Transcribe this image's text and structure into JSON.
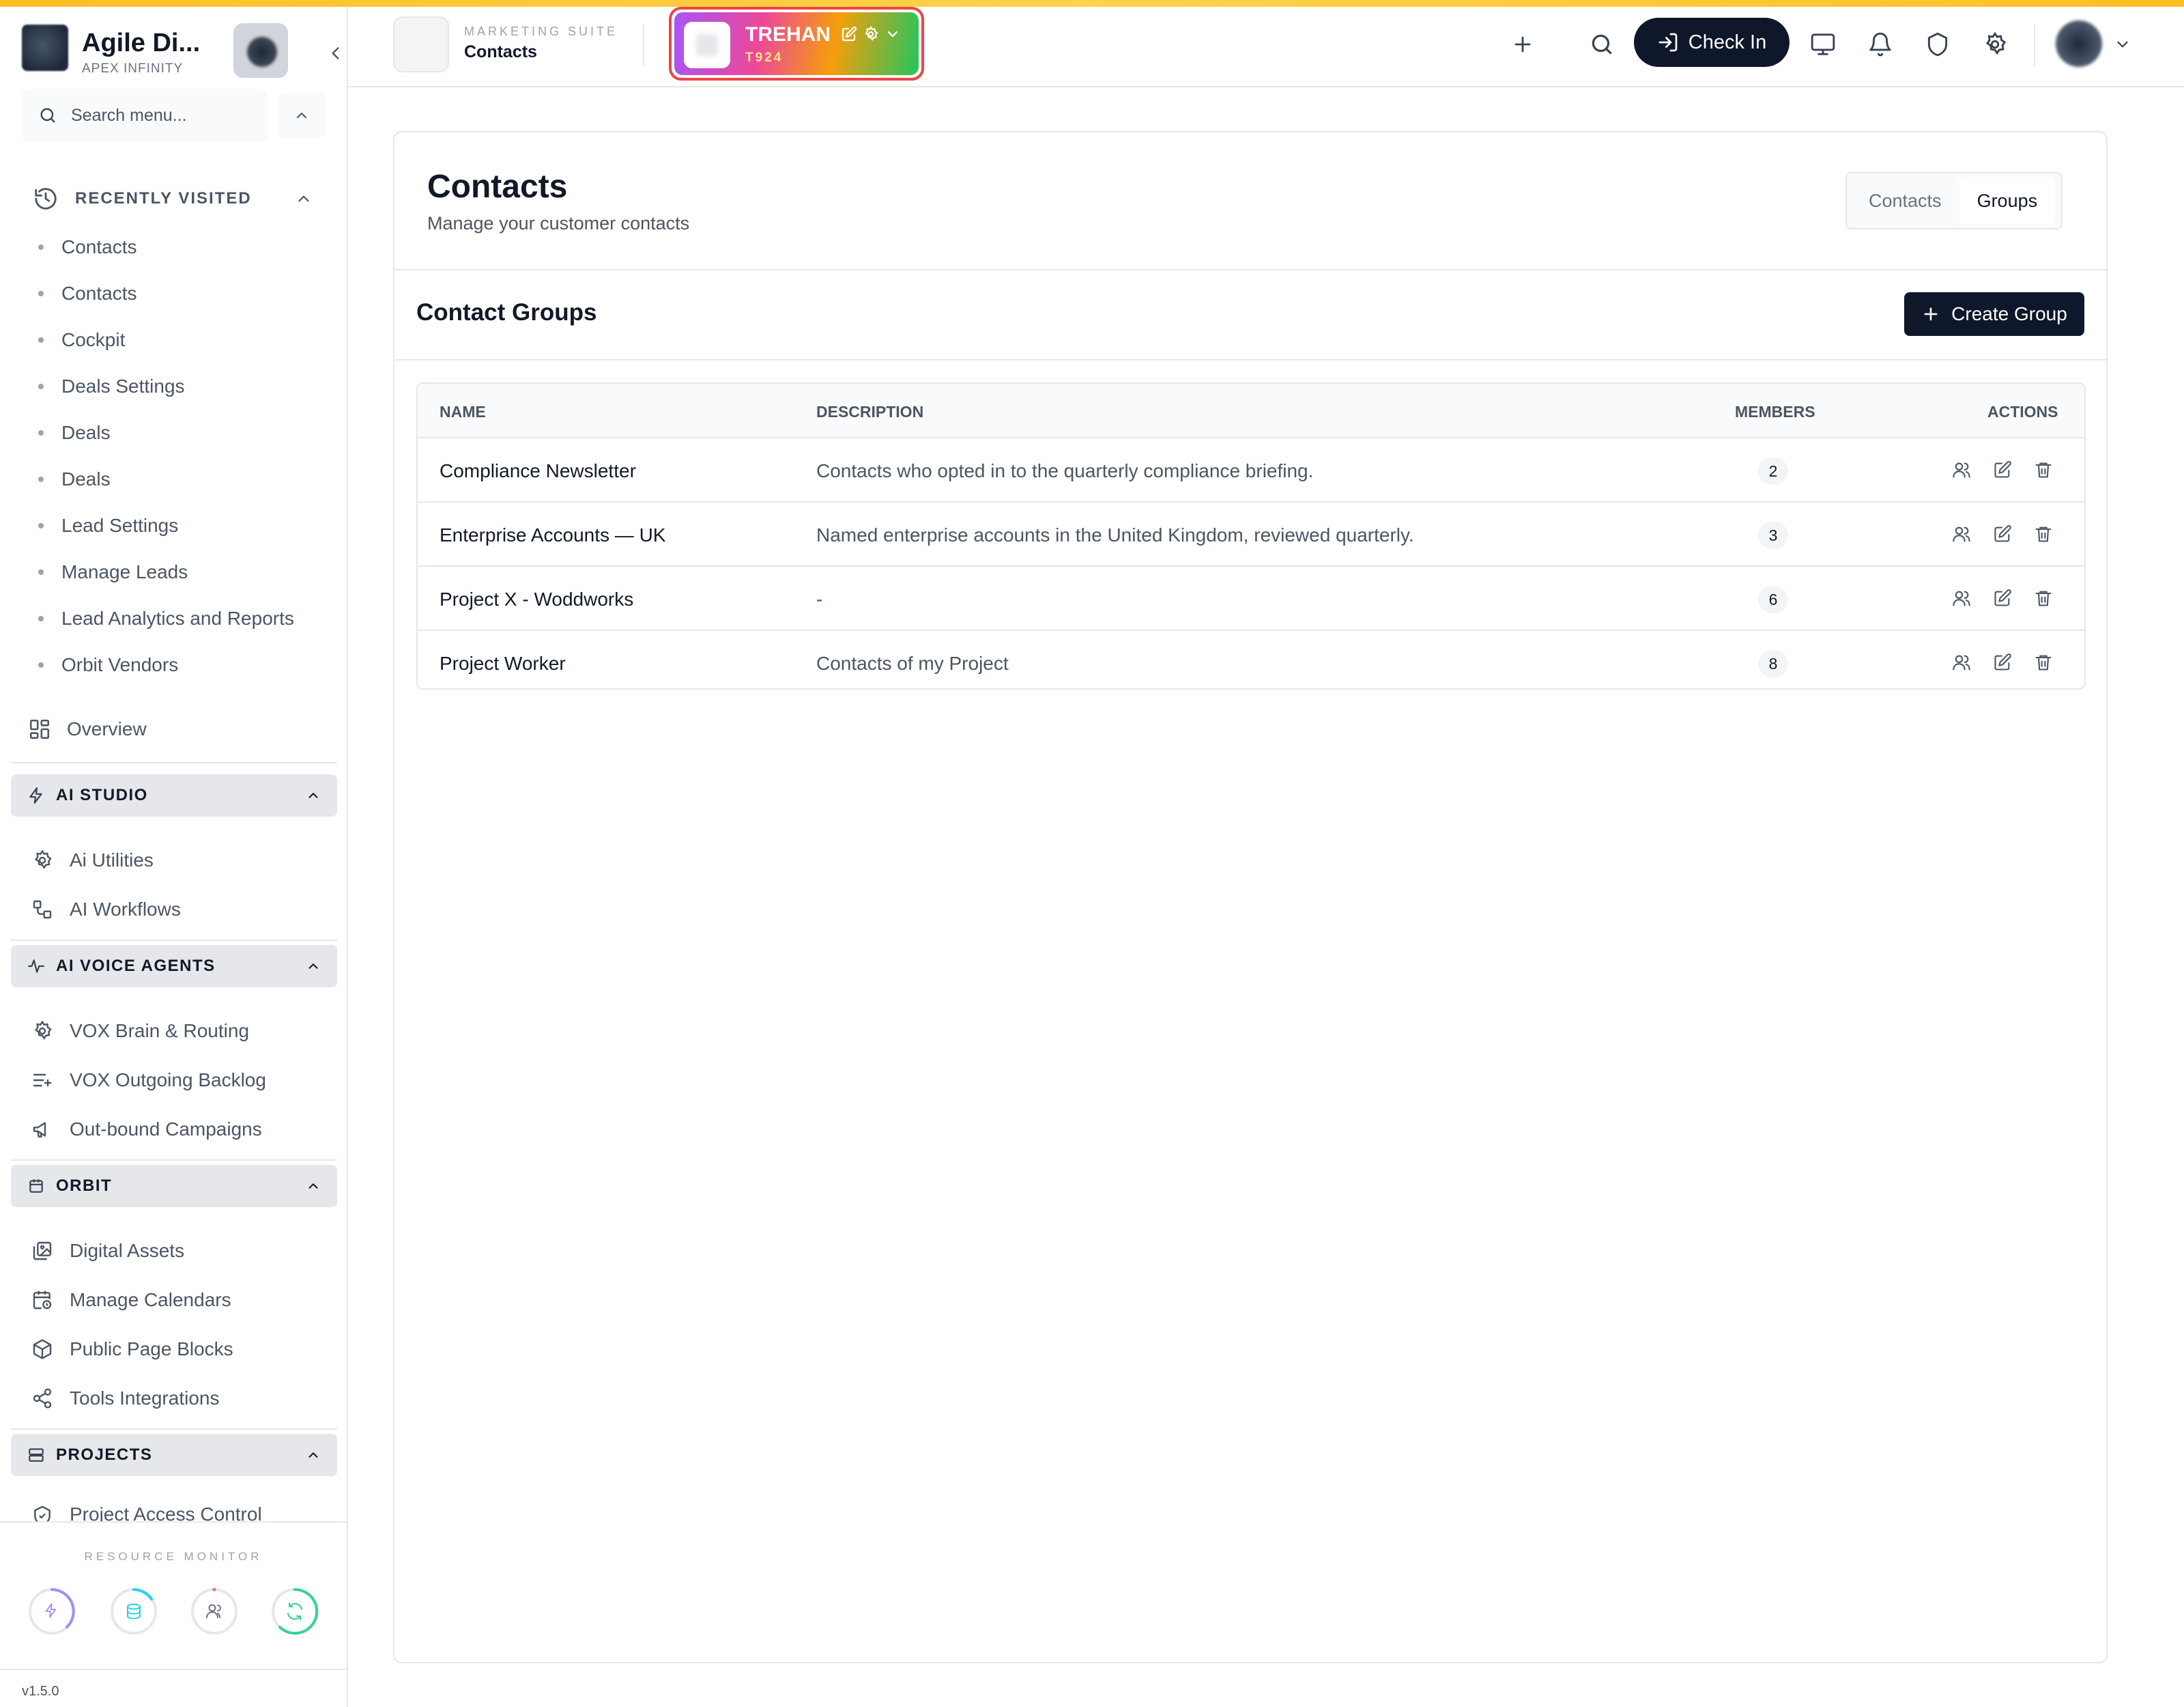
{
  "brand": {
    "name": "Agile Di...",
    "subtitle": "APEX INFINITY"
  },
  "search": {
    "placeholder": "Search menu..."
  },
  "recently_visited": {
    "label": "RECENTLY VISITED",
    "items": [
      "Contacts",
      "Contacts",
      "Cockpit",
      "Deals Settings",
      "Deals",
      "Deals",
      "Lead Settings",
      "Manage Leads",
      "Lead Analytics and Reports",
      "Orbit Vendors"
    ]
  },
  "nav": {
    "overview": "Overview",
    "ai_studio": {
      "label": "AI STUDIO",
      "items": [
        "Ai Utilities",
        "AI Workflows"
      ]
    },
    "ai_voice_agents": {
      "label": "AI VOICE AGENTS",
      "items": [
        "VOX Brain & Routing",
        "VOX Outgoing Backlog",
        "Out-bound Campaigns"
      ]
    },
    "orbit": {
      "label": "ORBIT",
      "items": [
        "Digital Assets",
        "Manage Calendars",
        "Public Page Blocks",
        "Tools Integrations"
      ]
    },
    "projects": {
      "label": "PROJECTS",
      "items": [
        "Project Access Control"
      ]
    }
  },
  "resource_monitor": {
    "label": "RESOURCE MONITOR"
  },
  "version": "v1.5.0",
  "header": {
    "app_suite": "MARKETING SUITE",
    "app_title": "Contacts",
    "tenant_name": "TREHAN",
    "tenant_code": "T924",
    "checkin_label": "Check In"
  },
  "page": {
    "title": "Contacts",
    "subtitle": "Manage your customer contacts",
    "tabs": [
      {
        "label": "Contacts",
        "active": false
      },
      {
        "label": "Groups",
        "active": true
      }
    ],
    "section_title": "Contact Groups",
    "create_label": "Create Group"
  },
  "table": {
    "columns": [
      "NAME",
      "DESCRIPTION",
      "MEMBERS",
      "ACTIONS"
    ],
    "rows": [
      {
        "name": "Compliance Newsletter",
        "description": "Contacts who opted in to the quarterly compliance briefing.",
        "members": "2"
      },
      {
        "name": "Enterprise Accounts — UK",
        "description": "Named enterprise accounts in the United Kingdom, reviewed quarterly.",
        "members": "3"
      },
      {
        "name": "Project X - Woddworks",
        "description": "-",
        "members": "6"
      },
      {
        "name": "Project Worker",
        "description": "Contacts of my Project",
        "members": "8"
      }
    ]
  },
  "colors": {
    "primary": "#0f172a",
    "accent_bar": "#fbbf24",
    "tenant_border": "#ef4444"
  }
}
